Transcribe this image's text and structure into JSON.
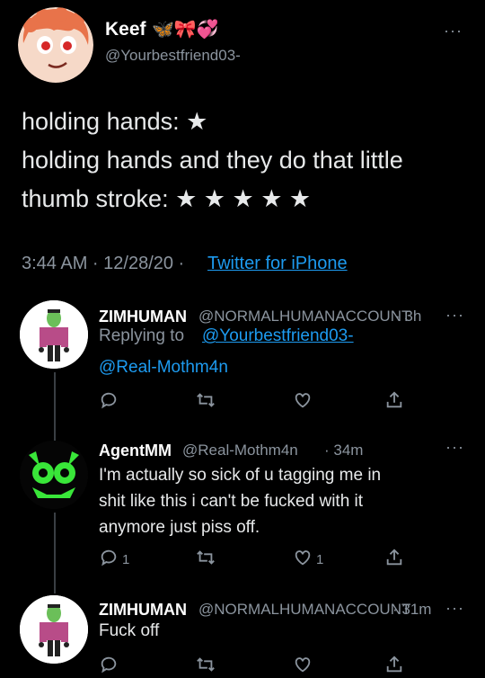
{
  "author": {
    "name": "Keef",
    "emoji": "🦋🎀💞",
    "handle": "@Yourbestfriend03-"
  },
  "tweet": {
    "line1": "holding hands: ★",
    "line2": "holding hands and they do that little",
    "line3": "thumb stroke: ★ ★ ★ ★ ★",
    "time": "3:44 AM · 12/28/20 ·",
    "source": "Twitter for iPhone"
  },
  "replies": [
    {
      "name": "ZIMHUMAN",
      "handle": "@NORMALHUMANACCOUNT",
      "time": "· 3h",
      "replying_prefix": "Replying to",
      "replying_to": "@Yourbestfriend03-",
      "text": "@Real-Mothm4n",
      "reply_count": "",
      "like_count": ""
    },
    {
      "name": "AgentMM",
      "handle": "@Real-Mothm4n",
      "time": "· 34m",
      "text_lines": [
        "I'm actually so sick of u tagging me in",
        "shit like this i can't be fucked with it",
        "anymore just piss off."
      ],
      "reply_count": "1",
      "like_count": "1"
    },
    {
      "name": "ZIMHUMAN",
      "handle": "@NORMALHUMANACCOUNT",
      "time": "· 31m",
      "text": "Fuck off"
    }
  ],
  "more_menu": "···",
  "colors": {
    "background": "#000000",
    "link": "#1d9bf0",
    "muted": "#8b949e"
  },
  "icons": [
    "reply-icon",
    "retweet-icon",
    "like-icon",
    "share-icon",
    "more-icon"
  ]
}
